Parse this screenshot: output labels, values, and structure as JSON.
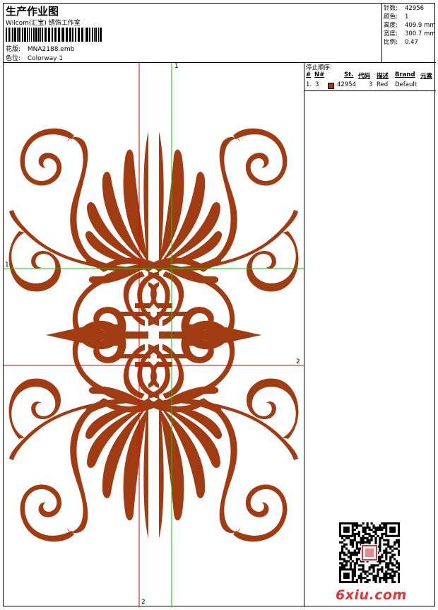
{
  "header": {
    "title": "生产作业图",
    "company": "Wilcom(汇宝) 绣饰工作室",
    "design_label": "花版:",
    "design_value": "MNA2188.emb",
    "colorway_label": "色位:",
    "colorway_value": "Colorway 1"
  },
  "specs": [
    {
      "label": "针数:",
      "value": "42956"
    },
    {
      "label": "颜色:",
      "value": "1"
    },
    {
      "label": "高度:",
      "value": "409.9 mm"
    },
    {
      "label": "宽度:",
      "value": "300.7 mm"
    },
    {
      "label": "比例:",
      "value": "0.47"
    }
  ],
  "stop_sequence": {
    "title": "停止顺序:",
    "columns": [
      "#",
      "N#",
      "St.",
      "代码",
      "描述",
      "Brand",
      "元素"
    ],
    "rows": [
      {
        "index": "1.",
        "needle": "3",
        "stitches": "42954",
        "code": "3",
        "description": "Red",
        "brand": "Default",
        "swatch_color": "#a13b12"
      }
    ]
  },
  "guides": {
    "h1": "1",
    "v1": "1",
    "h2": "2",
    "v2": "2"
  },
  "colors": {
    "thread": "#a13b12",
    "guide_red": "#e60000",
    "guide_green": "#00d000"
  },
  "watermark": "6xiu.com",
  "stamp_icon": "seal-stamp-icon"
}
